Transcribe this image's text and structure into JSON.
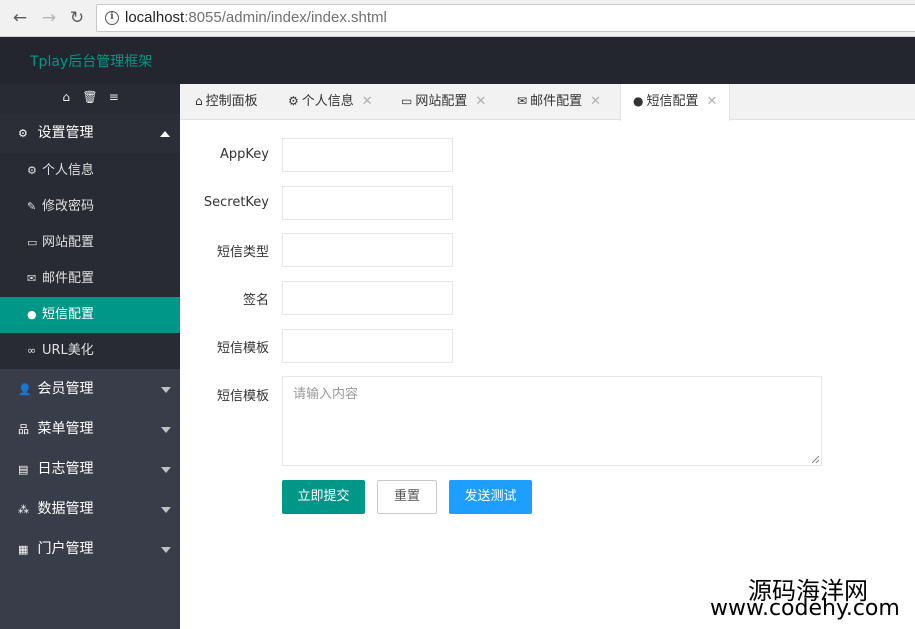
{
  "browser": {
    "back_icon": "←",
    "forward_icon": "→",
    "reload_icon": "↻",
    "url_host": "localhost",
    "url_path": ":8055/admin/index/index.shtml"
  },
  "header": {
    "brand": "Tplay后台管理框架"
  },
  "sidebar": {
    "tools": [
      "⌂",
      "🗑",
      "≡"
    ],
    "groups": [
      {
        "icon": "⚙",
        "label": "设置管理"
      },
      {
        "icon": "👤",
        "label": "会员管理"
      },
      {
        "icon": "品",
        "label": "菜单管理"
      },
      {
        "icon": "▤",
        "label": "日志管理"
      },
      {
        "icon": "⁂",
        "label": "数据管理"
      },
      {
        "icon": "▦",
        "label": "门户管理"
      }
    ],
    "sub_items": [
      {
        "icon": "⚙",
        "label": "个人信息"
      },
      {
        "icon": "✎",
        "label": "修改密码"
      },
      {
        "icon": "▭",
        "label": "网站配置"
      },
      {
        "icon": "✉",
        "label": "邮件配置"
      },
      {
        "icon": "●",
        "label": "短信配置"
      },
      {
        "icon": "∞",
        "label": "URL美化"
      }
    ]
  },
  "tabs": [
    {
      "icon": "⌂",
      "label": "控制面板",
      "close": ""
    },
    {
      "icon": "⚙",
      "label": "个人信息",
      "close": "✕"
    },
    {
      "icon": "▭",
      "label": "网站配置",
      "close": "✕"
    },
    {
      "icon": "✉",
      "label": "邮件配置",
      "close": "✕"
    },
    {
      "icon": "●",
      "label": "短信配置",
      "close": "✕"
    }
  ],
  "form": {
    "fields": [
      {
        "label": "AppKey",
        "value": ""
      },
      {
        "label": "SecretKey",
        "value": ""
      },
      {
        "label": "短信类型",
        "value": ""
      },
      {
        "label": "签名",
        "value": ""
      },
      {
        "label": "短信模板",
        "value": ""
      }
    ],
    "textarea_label": "短信模板",
    "textarea_placeholder": "请输入内容",
    "submit_label": "立即提交",
    "reset_label": "重置",
    "test_label": "发送测试"
  },
  "watermark": {
    "cn": "源码海洋网",
    "url": "www.codehy.com"
  },
  "colors": {
    "accent": "#009688",
    "header_bg": "#23262e",
    "sidebar_bg": "#393d49",
    "test_button": "#1e9fff"
  }
}
